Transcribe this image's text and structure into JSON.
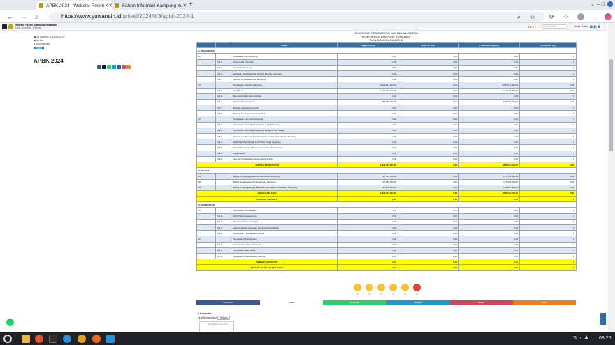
{
  "browser": {
    "tabs": [
      {
        "label": "APBK 2024 - Website Resmi K",
        "active": true
      },
      {
        "label": "Sistem Informasi Kampung Yu",
        "active": false
      }
    ],
    "new_tab": "+",
    "url_host": "https://www.yuwanain.id",
    "url_path": "/artikel/2024/8/3/apbk-2024-1",
    "clock": "08:20"
  },
  "site": {
    "name": "Website Resmi Kampung Yuwanain",
    "region": "Distr. Arso Kab. Keerom",
    "search_placeholder": "Cari Artikel",
    "login": "Anda Online"
  },
  "post": {
    "date": "03 Agustus 2024 08:14:47",
    "views": "46 kali",
    "author": "Administrator",
    "title": "APBK 2024",
    "share_btn": "Share"
  },
  "doc": {
    "line1": "ANGGARAN PENDAPATAN DAN BELANJA DESA",
    "line2": "PEMERINTAH KAMPUNG YUWANAIN",
    "line3": "TAHUN ANGGARAN 2024"
  },
  "table": {
    "headers": [
      "",
      "",
      "Uraian",
      "Anggaran (Rp)",
      "Realisasi (Rp)",
      "Lebih/(Kurang)(Rp)",
      "Persentase (%)"
    ],
    "rows": [
      {
        "t": "sec",
        "c": [
          "1. PENDAPATAN",
          "",
          "",
          "",
          "",
          "",
          ""
        ]
      },
      {
        "t": "w",
        "c": [
          "4.1.",
          "",
          "Pendapatan Asli Kampung",
          "0,00",
          "0,00",
          "0,00",
          "0"
        ]
      },
      {
        "t": "b",
        "c": [
          "",
          "4.1.1.",
          "Hasil Usaha Kampung",
          "0,00",
          "0,00",
          "0,00",
          "0"
        ]
      },
      {
        "t": "w",
        "c": [
          "",
          "4.1.2.",
          "Hasil Aset Kampung",
          "0,00",
          "0,00",
          "0,00",
          "0"
        ]
      },
      {
        "t": "b",
        "c": [
          "",
          "4.1.3.",
          "Swadaya, Partisipasi Dan Gotong Royong Kampung",
          "0,00",
          "0,00",
          "0,00",
          "0"
        ]
      },
      {
        "t": "w",
        "c": [
          "",
          "4.1.4.",
          "Lain-lain Pendapatan Asli Kampung",
          "0,00",
          "0,00",
          "0,00",
          "0"
        ]
      },
      {
        "t": "b",
        "c": [
          "4.2.",
          "",
          "Pendapatan Transfer Kampung",
          "1.800.511.000,00",
          "0,00",
          "1.800.511.000,00",
          "0,00"
        ]
      },
      {
        "t": "w",
        "c": [
          "",
          "4.2.1.",
          "Dana Desa",
          "1.144.145.000,00",
          "0,00",
          "1.144.145.000,00",
          "0,00"
        ]
      },
      {
        "t": "b",
        "c": [
          "",
          "4.2.2.",
          "Bagi Hasil Pajak Dan Retribusi",
          "0,00",
          "0,00",
          "0,00",
          "0"
        ]
      },
      {
        "t": "w",
        "c": [
          "",
          "4.2.3.",
          "Alokasi Dana Kampung",
          "656.366.000,00",
          "0,00",
          "656.366.000,00",
          "0,00"
        ]
      },
      {
        "t": "b",
        "c": [
          "",
          "4.2.4.",
          "Bantuan Keuangan Provinsi",
          "0,00",
          "0,00",
          "0,00",
          "0"
        ]
      },
      {
        "t": "w",
        "c": [
          "",
          "4.2.5.",
          "Bantuan Keuangan Kabupaten/Kota",
          "0,00",
          "0,00",
          "0,00",
          "0"
        ]
      },
      {
        "t": "b",
        "c": [
          "4.3.",
          "",
          "Pendapatan Lain-Lain Kampung",
          "0,00",
          "0,00",
          "0,00",
          "0"
        ]
      },
      {
        "t": "w",
        "c": [
          "",
          "4.3.1.",
          "Penerimaan Dari Hasil Kerjasama Antar Kampung",
          "0,00",
          "0,00",
          "0,00",
          "0"
        ]
      },
      {
        "t": "b",
        "c": [
          "",
          "4.3.2.",
          "Penerimaan Dari Hasil Kerjasama Dengan Pihak Ketiga",
          "0,00",
          "0,00",
          "0,00",
          "0"
        ]
      },
      {
        "t": "w",
        "c": [
          "",
          "4.3.3.",
          "Penerimaan Bantuan Dari Perusahaan Yang Berlokasi Di Kampung",
          "0,00",
          "0,00",
          "0,00",
          "0"
        ]
      },
      {
        "t": "b",
        "c": [
          "",
          "4.3.4.",
          "Hibah Dan Sumbangan Dari Pihak Ketiga Kampung",
          "0,00",
          "0,00",
          "0,00",
          "0"
        ]
      },
      {
        "t": "w",
        "c": [
          "",
          "4.3.5.",
          "Koreksi Kesalahan Belanja Tahun-Tahun Sebelumnya",
          "0,00",
          "0,00",
          "0,00",
          "0"
        ]
      },
      {
        "t": "b",
        "c": [
          "",
          "4.3.6.",
          "Bunga Bank",
          "0,00",
          "0,00",
          "0,00",
          "0"
        ]
      },
      {
        "t": "w",
        "c": [
          "",
          "4.3.9.",
          "Lain-Lain Pendapatan Kampung Yang Sah",
          "0,00",
          "0,00",
          "0,00",
          "0"
        ]
      },
      {
        "t": "y",
        "c": [
          "",
          "",
          "JUMLAH PENDAPATAN",
          "1.800.511.000,00",
          "0,00",
          "1.800.511.000,00",
          "0,00"
        ]
      },
      {
        "t": "sec",
        "c": [
          "2. BELANJA",
          "",
          "",
          "",
          "",
          "",
          ""
        ]
      },
      {
        "t": "b",
        "c": [
          "01",
          "",
          "Bidang Penyelenggaraan Pemerintahan Kampung",
          "857.796.000,00",
          "0,00",
          "857.796.000,00",
          "0,00"
        ]
      },
      {
        "t": "w",
        "c": [
          "02",
          "",
          "Bidang Pelaksanaan Pembangunan Kampung",
          "772.460.000,00",
          "0,00",
          "772.460.000,00",
          "0,00"
        ]
      },
      {
        "t": "b",
        "c": [
          "05",
          "",
          "Bidang Penanggulangan Bencana, Darurat Dan Mendesak Kampung",
          "156.405.000,00",
          "0,00",
          "156.405.000,00",
          "0,00"
        ]
      },
      {
        "t": "y",
        "c": [
          "",
          "",
          "JUMLAH BELANJA",
          "1.800.511.000,00",
          "0,00",
          "1.800.511.000,00",
          "0,00"
        ]
      },
      {
        "t": "y",
        "c": [
          "",
          "",
          "SURPLUS / (DEFISIT)",
          "0,00",
          "0,00",
          "0,00",
          "0"
        ]
      },
      {
        "t": "sec",
        "c": [
          "3. PEMBIAYAAN",
          "",
          "",
          "",
          "",
          "",
          ""
        ]
      },
      {
        "t": "w",
        "c": [
          "6.1.",
          "",
          "Penerimaan Pembiayaan",
          "0,00",
          "0,00",
          "0,00",
          "0"
        ]
      },
      {
        "t": "b",
        "c": [
          "",
          "6.1.1.",
          "SILPA Tahun Sebelumnya",
          "0,00",
          "0,00",
          "0,00",
          "0"
        ]
      },
      {
        "t": "w",
        "c": [
          "",
          "6.1.2.",
          "Pencairan Dana Cadangan",
          "0,00",
          "0,00",
          "0,00",
          "0"
        ]
      },
      {
        "t": "b",
        "c": [
          "",
          "6.1.3.",
          "Hasil Penjualan Kekayaan Desa Yang Dipisahkan",
          "0,00",
          "0,00",
          "0,00",
          "0"
        ]
      },
      {
        "t": "w",
        "c": [
          "",
          "6.1.9.",
          "Penerimaan Pembiayaan Lainnya",
          "0,00",
          "0,00",
          "0,00",
          "0"
        ]
      },
      {
        "t": "b",
        "c": [
          "6.2.",
          "",
          "Pengeluaran Pembiayaan",
          "0,00",
          "0,00",
          "0,00",
          "0"
        ]
      },
      {
        "t": "w",
        "c": [
          "",
          "6.2.1.",
          "Pembentukan Dana Cadangan",
          "0,00",
          "0,00",
          "0,00",
          "0"
        ]
      },
      {
        "t": "b",
        "c": [
          "",
          "6.2.2.",
          "Penyertaan Modal Desa",
          "0,00",
          "0,00",
          "0,00",
          "0"
        ]
      },
      {
        "t": "w",
        "c": [
          "",
          "6.2.9.",
          "Pengeluaran Pembiayaan Lainnya",
          "0,00",
          "0,00",
          "0,00",
          "0"
        ]
      },
      {
        "t": "y",
        "c": [
          "",
          "",
          "PEMBIAYAAN NETTO",
          "0,00",
          "0,00",
          "0,00",
          "0"
        ]
      },
      {
        "t": "y",
        "c": [
          "",
          "",
          "SILPA/SILPA TAHUN BERJALAN",
          "0,00",
          "0,00",
          "0,00",
          "0"
        ]
      }
    ]
  },
  "reactions": [
    {
      "icon": "smile-icon",
      "count": "0"
    },
    {
      "icon": "love-icon",
      "count": "0"
    },
    {
      "icon": "laugh-icon",
      "count": "0"
    },
    {
      "icon": "wow-icon",
      "count": "0"
    },
    {
      "icon": "sad-icon",
      "count": "0"
    },
    {
      "icon": "angry-icon",
      "count": "0"
    }
  ],
  "sharebar": [
    {
      "label": "Facebook",
      "color": "#3b5998"
    },
    {
      "label": "Twitter",
      "color": "#ffffff"
    },
    {
      "label": "WhatsApp",
      "color": "#25d366"
    },
    {
      "label": "Telegram",
      "color": "#1d9bd1"
    },
    {
      "label": "Email",
      "color": "#d3455b"
    },
    {
      "label": "Print",
      "color": "#e8821e"
    }
  ],
  "comments": {
    "count_label": "0 Komentar",
    "sort_label": "Urut Berdasarkan",
    "sort_value": "Terbaru",
    "box_text": "Tambahkan komentar..."
  }
}
